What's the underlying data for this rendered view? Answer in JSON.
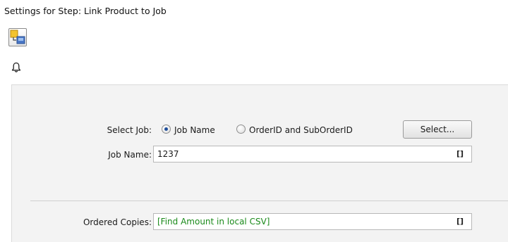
{
  "window": {
    "title": "Settings for Step: Link Product to Job"
  },
  "select_job": {
    "label": "Select Job:",
    "options": [
      {
        "label": "Job Name",
        "selected": true
      },
      {
        "label": "OrderID and SubOrderID",
        "selected": false
      }
    ],
    "button_label": "Select..."
  },
  "job_name": {
    "label": "Job Name:",
    "value": "1237",
    "indicator": "[]"
  },
  "ordered_copies": {
    "label": "Ordered Copies:",
    "value": "[Find Amount in local CSV]",
    "value_color": "#1a8a1a",
    "indicator": "[]"
  },
  "icons": {
    "step_icon": "link-product-to-job-step-icon",
    "notification_icon": "bell-icon",
    "radio_icon": "radio-button-icon"
  },
  "colors": {
    "panel_background": "#f3f3f3",
    "radio_dot": "#1f4e9a",
    "step_icon_yellow": "#f4c430",
    "step_icon_blue": "#4a78c8"
  }
}
